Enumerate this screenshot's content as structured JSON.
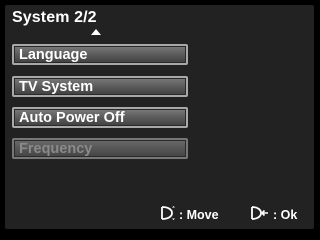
{
  "header": {
    "title": "System 2/2"
  },
  "menu": {
    "items": [
      {
        "label": "Language",
        "enabled": true
      },
      {
        "label": "TV System",
        "enabled": true
      },
      {
        "label": "Auto Power Off",
        "enabled": true
      },
      {
        "label": "Frequency",
        "enabled": false
      }
    ]
  },
  "footer": {
    "move_label": ": Move",
    "ok_label": ": Ok",
    "move_icon": "dpad-up-down-icon",
    "ok_icon": "dpad-ok-icon"
  }
}
